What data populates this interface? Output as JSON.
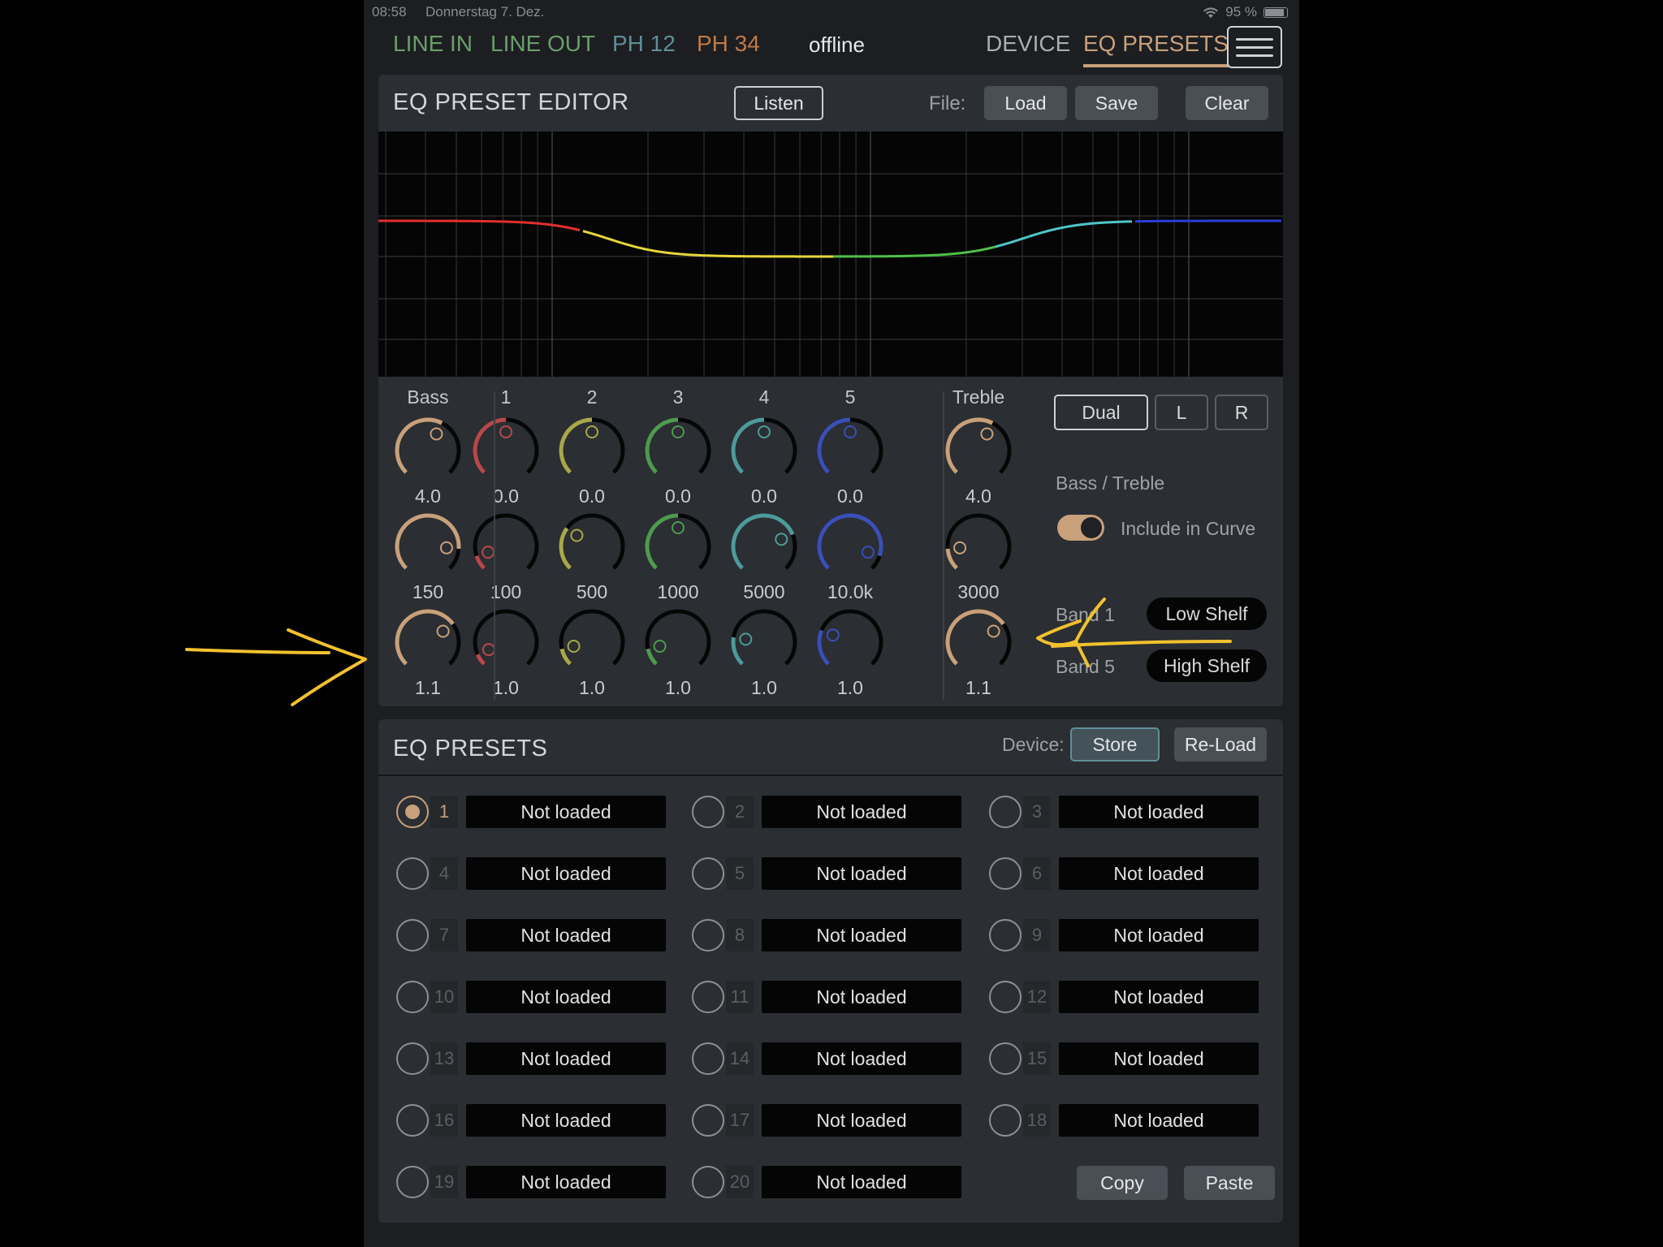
{
  "status": {
    "time": "08:58",
    "date": "Donnerstag 7. Dez.",
    "battery": "95 %"
  },
  "nav": {
    "tabs": [
      {
        "label": "LINE IN",
        "color": "#6b9e6b"
      },
      {
        "label": "LINE OUT",
        "color": "#6b9e6b"
      },
      {
        "label": "PH 12",
        "color": "#5f8f97"
      },
      {
        "label": "PH 34",
        "color": "#c07a45"
      }
    ],
    "connection": "offline",
    "device_tab": "DEVICE",
    "presets_tab": "EQ PRESETS"
  },
  "editor": {
    "title": "EQ PRESET EDITOR",
    "listen_label": "Listen",
    "file_label": "File:",
    "load_label": "Load",
    "save_label": "Save",
    "clear_label": "Clear"
  },
  "knobs": {
    "columns": [
      {
        "label": "Bass",
        "color": "#c8a07a",
        "gain": "4.0",
        "freq": "150",
        "q": "1.1"
      },
      {
        "label": "1",
        "color": "#b8484a",
        "gain": "0.0",
        "freq": "100",
        "q": "1.0"
      },
      {
        "label": "2",
        "color": "#a8a848",
        "gain": "0.0",
        "freq": "500",
        "q": "1.0"
      },
      {
        "label": "3",
        "color": "#4e9a4e",
        "gain": "0.0",
        "freq": "1000",
        "q": "1.0"
      },
      {
        "label": "4",
        "color": "#4e9a9a",
        "gain": "0.0",
        "freq": "5000",
        "q": "1.0"
      },
      {
        "label": "5",
        "color": "#3a4fb8",
        "gain": "0.0",
        "freq": "10.0k",
        "q": "1.0"
      },
      {
        "label": "Treble",
        "color": "#c8a07a",
        "gain": "4.0",
        "freq": "3000",
        "q": "1.1"
      }
    ],
    "levels": {
      "gain": [
        0.6,
        0.5,
        0.5,
        0.5,
        0.5,
        0.5,
        0.6
      ],
      "freq": [
        0.85,
        0.1,
        0.3,
        0.5,
        0.75,
        0.9,
        0.15
      ],
      "q": [
        0.7,
        0.08,
        0.12,
        0.12,
        0.2,
        0.25,
        0.7
      ]
    }
  },
  "channel": {
    "dual_label": "Dual",
    "left_label": "L",
    "right_label": "R"
  },
  "bass_treble": {
    "heading": "Bass / Treble",
    "include_label": "Include in Curve",
    "include_on": true,
    "band1_label": "Band 1",
    "band1_type": "Low Shelf",
    "band5_label": "Band 5",
    "band5_type": "High Shelf"
  },
  "presets": {
    "title": "EQ PRESETS",
    "device_label": "Device:",
    "store_label": "Store",
    "reload_label": "Re-Load",
    "selected": 1,
    "items": [
      {
        "num": "1",
        "name": "Not loaded"
      },
      {
        "num": "2",
        "name": "Not loaded"
      },
      {
        "num": "3",
        "name": "Not loaded"
      },
      {
        "num": "4",
        "name": "Not loaded"
      },
      {
        "num": "5",
        "name": "Not loaded"
      },
      {
        "num": "6",
        "name": "Not loaded"
      },
      {
        "num": "7",
        "name": "Not loaded"
      },
      {
        "num": "8",
        "name": "Not loaded"
      },
      {
        "num": "9",
        "name": "Not loaded"
      },
      {
        "num": "10",
        "name": "Not loaded"
      },
      {
        "num": "11",
        "name": "Not loaded"
      },
      {
        "num": "12",
        "name": "Not loaded"
      },
      {
        "num": "13",
        "name": "Not loaded"
      },
      {
        "num": "14",
        "name": "Not loaded"
      },
      {
        "num": "15",
        "name": "Not loaded"
      },
      {
        "num": "16",
        "name": "Not loaded"
      },
      {
        "num": "17",
        "name": "Not loaded"
      },
      {
        "num": "18",
        "name": "Not loaded"
      },
      {
        "num": "19",
        "name": "Not loaded"
      },
      {
        "num": "20",
        "name": "Not loaded"
      }
    ],
    "copy_label": "Copy",
    "paste_label": "Paste"
  },
  "annotation_color": "#f2c12e"
}
